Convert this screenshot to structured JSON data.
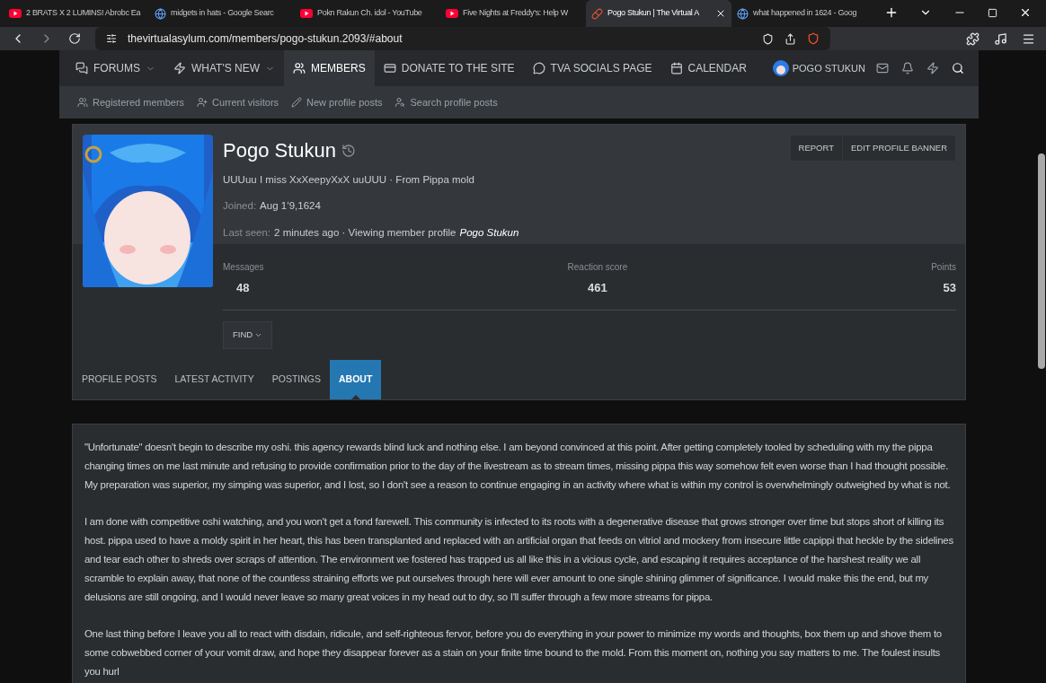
{
  "browser": {
    "tabs": [
      {
        "title": "2 BRATS X 2 LUMINS! Abrobc Ea",
        "kind": "video",
        "selected": false
      },
      {
        "title": "midgets in hats - Google Searc",
        "kind": "google",
        "selected": false
      },
      {
        "title": "Pokn Rakun Ch. idol - YouTube",
        "kind": "video",
        "selected": false
      },
      {
        "title": "Five Nights at Freddy's: Help W",
        "kind": "video",
        "selected": false
      },
      {
        "title": "Pogo Stukun | The Virtual A",
        "kind": "site",
        "selected": true
      },
      {
        "title": "what happened in 1624 - Goog",
        "kind": "google",
        "selected": false
      }
    ],
    "url": "thevirtualasylum.com/members/pogo-stukun.2093/#about"
  },
  "nav": {
    "items": [
      {
        "label": "FORUMS",
        "dropdown": true,
        "selected": false
      },
      {
        "label": "WHAT'S NEW",
        "dropdown": true,
        "selected": false
      },
      {
        "label": "MEMBERS",
        "dropdown": false,
        "selected": true
      },
      {
        "label": "DONATE TO THE SITE",
        "dropdown": false,
        "selected": false
      },
      {
        "label": "TVA SOCIALS PAGE",
        "dropdown": false,
        "selected": false
      },
      {
        "label": "CALENDAR",
        "dropdown": false,
        "selected": false
      }
    ],
    "user": "POGO STUKUN",
    "subnav": [
      "Registered members",
      "Current visitors",
      "New profile posts",
      "Search profile posts"
    ]
  },
  "profile": {
    "name": "Pogo Stukun",
    "title": "UUUuu I miss XxXeepyXxX uuUUU · From Pippa mold",
    "joined_label": "Joined:",
    "joined": "Aug 1ʻ9,1624",
    "last_seen_label": "Last seen:",
    "last_seen": "2 minutes ago · Viewing member profile",
    "last_seen_link": "Pogo Stukun",
    "actions": [
      "REPORT",
      "EDIT PROFILE BANNER"
    ],
    "stats": [
      {
        "label": "Messages",
        "value": "48"
      },
      {
        "label": "Reaction score",
        "value": "461"
      },
      {
        "label": "Points",
        "value": "53"
      }
    ],
    "find": "FIND",
    "tabs": [
      {
        "label": "PROFILE POSTS",
        "selected": false
      },
      {
        "label": "LATEST ACTIVITY",
        "selected": false
      },
      {
        "label": "POSTINGS",
        "selected": false
      },
      {
        "label": "ABOUT",
        "selected": true
      }
    ]
  },
  "about": {
    "paragraphs": [
      "\"Unfortunate\" doesn't begin to describe my oshi. this agency rewards blind luck and nothing else. I am beyond convinced at this point. After getting completely tooled by scheduling with my the pippa changing times on me last minute and refusing to provide confirmation prior to the day of the livestream as to stream times, missing pippa this way somehow felt even worse than I had thought possible. My preparation was superior, my simping was superior, and I lost, so I don't see a reason to continue engaging in an activity where what is within my control is overwhelmingly outweighed by what is not.",
      "I am done with competitive oshi watching, and you won't get a fond farewell. This community is infected to its roots with a degenerative disease that grows stronger over time but stops short of killing its host. pippa used to have a moldy spirit in her heart, this has been transplanted and replaced with an artificial organ that feeds on vitriol and mockery from insecure little capippi that heckle by the sidelines and tear each other to shreds over scraps of attention. The environment we fostered has trapped us all like this in a vicious cycle, and escaping it requires acceptance of the harshest reality we all scramble to explain away, that none of the countless straining efforts we put ourselves through here will ever amount to one single shining glimmer of significance. I would make this the end, but my delusions are still ongoing, and I would never leave so many great voices in my head out to dry, so I'll suffer through a few more streams for pippa.",
      "One last thing before I leave you all to react with disdain, ridicule, and self-righteous fervor, before you do everything in your power to minimize my words and thoughts, box them up and shove them to some cobwebbed corner of your vomit draw, and hope they disappear forever as a stain on your finite time bound to the mold. From this moment on, nothing you say matters to me. The foulest insults you hurl"
    ]
  }
}
